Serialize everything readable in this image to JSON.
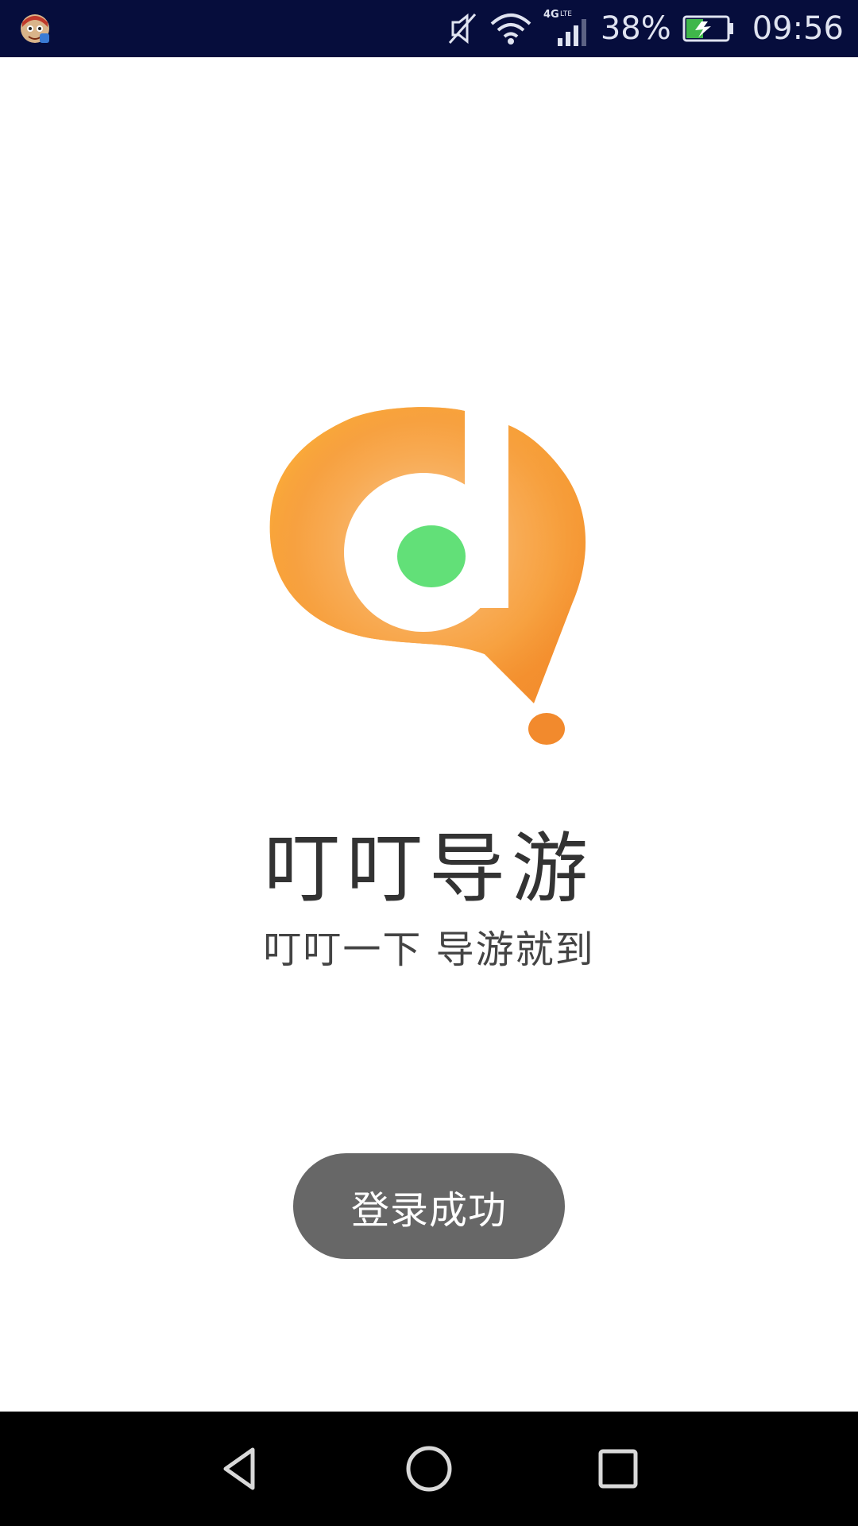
{
  "status_bar": {
    "battery_percent": "38%",
    "time": "09:56",
    "network_label": "4G LTE",
    "icons": [
      "app-notification-icon",
      "mute-icon",
      "wifi-icon",
      "signal-icon",
      "battery-charging-icon"
    ]
  },
  "app": {
    "title": "叮叮导游",
    "slogan": "叮叮一下 导游就到",
    "logo_icon": "app-logo-icon"
  },
  "toast": {
    "message": "登录成功"
  },
  "nav_bar": {
    "icons": [
      "back-icon",
      "home-icon",
      "recent-apps-icon"
    ]
  },
  "colors": {
    "status_bar_bg": "#060d3c",
    "logo_orange_light": "#fdb53b",
    "logo_orange_dark": "#f28a2d",
    "logo_green": "#62e078",
    "toast_bg": "#676767",
    "nav_bar_bg": "#000000"
  }
}
